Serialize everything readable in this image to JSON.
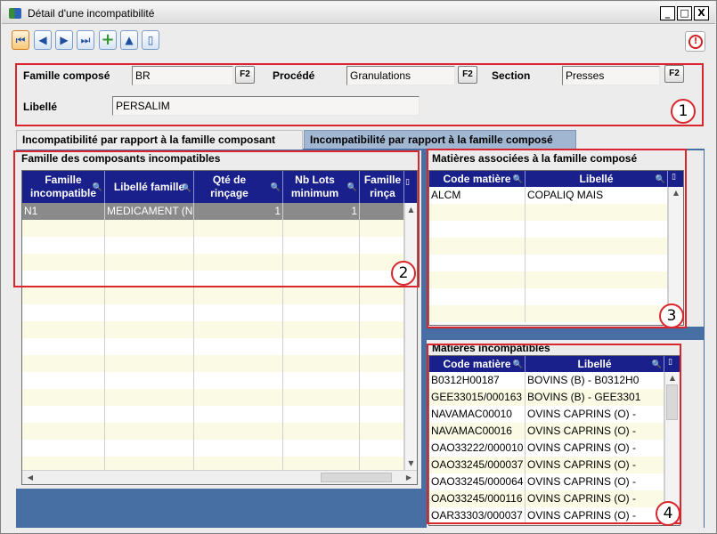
{
  "window": {
    "title": "Détail d'une incompatibilité",
    "min": "_",
    "max": "□",
    "close": "X"
  },
  "toolbar": {
    "first": "⏮",
    "prev": "◀",
    "next": "▶",
    "last": "⏭",
    "add": "+",
    "up": "▲",
    "doc": "▯"
  },
  "header": {
    "famille_label": "Famille composé",
    "famille_value": "BR",
    "procede_label": "Procédé",
    "procede_value": "Granulations",
    "section_label": "Section",
    "section_value": "Presses",
    "libelle_label": "Libellé",
    "libelle_value": "PERSALIM",
    "f2": "F2"
  },
  "annotations": [
    "1",
    "2",
    "3",
    "4"
  ],
  "tabs": [
    "Incompatibilité par rapport à la famille composant",
    "Incompatibilité par rapport à la famille composé"
  ],
  "panel_familles": {
    "title": "Famille des composants incompatibles",
    "columns": [
      "Famille incompatible",
      "Libellé famille",
      "Qté de rinçage",
      "Nb Lots minimum",
      "Famille rinça"
    ],
    "rows": [
      {
        "famille": "N1",
        "libelle": "MEDICAMENT (N",
        "qte": "1",
        "nb": "1",
        "rincage": ""
      }
    ]
  },
  "panel_matieres_associees": {
    "title": "Matières associées à la famille composé",
    "columns": [
      "Code matière",
      "Libellé"
    ],
    "rows": [
      {
        "code": "ALCM",
        "libelle": "COPALIQ MAIS"
      }
    ]
  },
  "panel_matieres_incompatibles": {
    "title": "Matières incompatibles",
    "columns": [
      "Code matière",
      "Libellé"
    ],
    "rows": [
      {
        "code": "B0312H00187",
        "libelle": "BOVINS (B) - B0312H0"
      },
      {
        "code": "GEE33015/000163",
        "libelle": "BOVINS (B) - GEE3301"
      },
      {
        "code": "NAVAMAC00010",
        "libelle": "OVINS CAPRINS (O) -"
      },
      {
        "code": "NAVAMAC00016",
        "libelle": "OVINS CAPRINS (O) -"
      },
      {
        "code": "OAO33222/000010",
        "libelle": "OVINS CAPRINS (O) -"
      },
      {
        "code": "OAO33245/000037",
        "libelle": "OVINS CAPRINS (O) -"
      },
      {
        "code": "OAO33245/000064",
        "libelle": "OVINS CAPRINS (O) -"
      },
      {
        "code": "OAO33245/000116",
        "libelle": "OVINS CAPRINS (O) -"
      },
      {
        "code": "OAR33303/000037",
        "libelle": "OVINS CAPRINS (O) -"
      }
    ]
  },
  "colors": {
    "accent": "#19208c",
    "annotation": "#d9262c",
    "content_bg": "#476fa3"
  }
}
